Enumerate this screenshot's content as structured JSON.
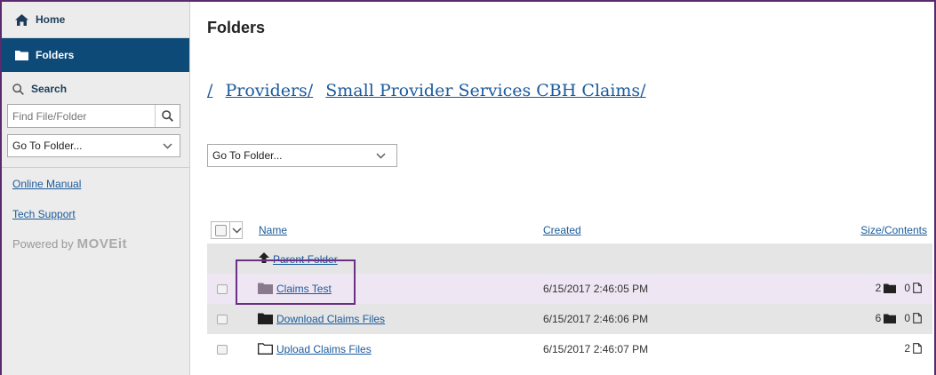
{
  "sidebar": {
    "home_label": "Home",
    "folders_label": "Folders",
    "search_label": "Search",
    "find_placeholder": "Find File/Folder",
    "goto_label": "Go To Folder...",
    "links": {
      "manual": "Online Manual",
      "tech": "Tech Support"
    },
    "powered_prefix": "Powered by",
    "powered_logo": "MOVEit"
  },
  "main": {
    "title": "Folders",
    "breadcrumb": {
      "root": "/",
      "items": [
        "Providers/",
        "Small Provider Services CBH Claims/"
      ]
    },
    "goto_label": "Go To Folder..."
  },
  "table": {
    "headers": {
      "name": "Name",
      "created": "Created",
      "size": "Size/Contents"
    },
    "parent_label": "Parent Folder",
    "rows": [
      {
        "name": "Claims Test",
        "created": "6/15/2017 2:46:05 PM",
        "folders": "2",
        "files": "0",
        "icon": "folder-filled-icon"
      },
      {
        "name": "Download Claims Files",
        "created": "6/15/2017 2:46:06 PM",
        "folders": "6",
        "files": "0",
        "icon": "folder-filled-icon"
      },
      {
        "name": "Upload Claims Files",
        "created": "6/15/2017 2:46:07 PM",
        "folders": "",
        "files": "2",
        "icon": "folder-outline-icon"
      }
    ]
  },
  "colors": {
    "accent": "#0d4a78",
    "link": "#1a5a9c",
    "highlight": "#6b2f84"
  }
}
